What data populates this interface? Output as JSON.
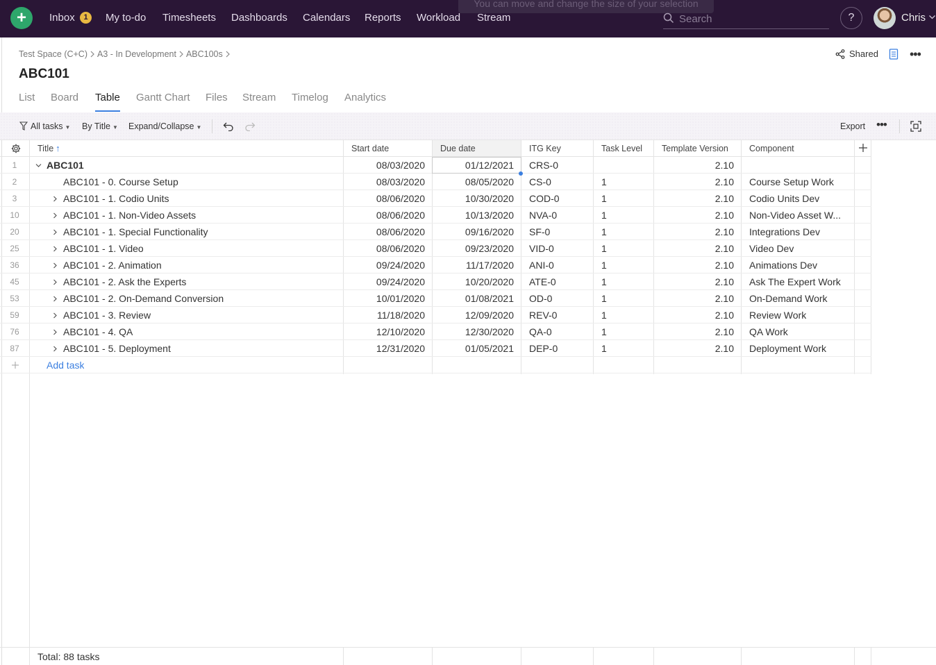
{
  "topbar": {
    "add_icon": "plus-icon",
    "nav": [
      {
        "label": "Inbox"
      },
      {
        "label": "My to-do"
      },
      {
        "label": "Timesheets"
      },
      {
        "label": "Dashboards"
      },
      {
        "label": "Calendars"
      },
      {
        "label": "Reports"
      },
      {
        "label": "Workload"
      },
      {
        "label": "Stream"
      }
    ],
    "inbox_badge": "1",
    "tooltip": "You can move and change the size of your selection",
    "search_placeholder": "Search",
    "help_label": "?",
    "user_name": "Chris"
  },
  "header": {
    "breadcrumb": [
      "Test Space (C+C)",
      "A3 - In Development",
      "ABC100s"
    ],
    "title": "ABC101",
    "shared_label": "Shared"
  },
  "tabs": [
    "List",
    "Board",
    "Table",
    "Gantt Chart",
    "Files",
    "Stream",
    "Timelog",
    "Analytics"
  ],
  "active_tab": "Table",
  "toolbar": {
    "filter_label": "All tasks",
    "sort_label": "By Title",
    "expand_label": "Expand/Collapse",
    "export_label": "Export"
  },
  "table": {
    "columns": [
      "Title",
      "Start date",
      "Due date",
      "ITG Key",
      "Task Level",
      "Template Version",
      "Component"
    ],
    "rows": [
      {
        "num": "1",
        "title": "ABC101",
        "start": "08/03/2020",
        "due": "01/12/2021",
        "key": "CRS-0",
        "level": "",
        "version": "2.10",
        "component": ""
      },
      {
        "num": "2",
        "title": "ABC101 - 0. Course Setup",
        "start": "08/03/2020",
        "due": "08/05/2020",
        "key": "CS-0",
        "level": "1",
        "version": "2.10",
        "component": "Course Setup Work"
      },
      {
        "num": "3",
        "title": "ABC101 - 1. Codio Units",
        "start": "08/06/2020",
        "due": "10/30/2020",
        "key": "COD-0",
        "level": "1",
        "version": "2.10",
        "component": "Codio Units Dev"
      },
      {
        "num": "10",
        "title": "ABC101 - 1. Non-Video Assets",
        "start": "08/06/2020",
        "due": "10/13/2020",
        "key": "NVA-0",
        "level": "1",
        "version": "2.10",
        "component": "Non-Video Asset W..."
      },
      {
        "num": "20",
        "title": "ABC101 - 1. Special Functionality",
        "start": "08/06/2020",
        "due": "09/16/2020",
        "key": "SF-0",
        "level": "1",
        "version": "2.10",
        "component": "Integrations Dev"
      },
      {
        "num": "25",
        "title": "ABC101 - 1. Video",
        "start": "08/06/2020",
        "due": "09/23/2020",
        "key": "VID-0",
        "level": "1",
        "version": "2.10",
        "component": "Video Dev"
      },
      {
        "num": "36",
        "title": "ABC101 - 2. Animation",
        "start": "09/24/2020",
        "due": "11/17/2020",
        "key": "ANI-0",
        "level": "1",
        "version": "2.10",
        "component": "Animations Dev"
      },
      {
        "num": "45",
        "title": "ABC101 - 2. Ask the Experts",
        "start": "09/24/2020",
        "due": "10/20/2020",
        "key": "ATE-0",
        "level": "1",
        "version": "2.10",
        "component": "Ask The Expert Work"
      },
      {
        "num": "53",
        "title": "ABC101 - 2. On-Demand Conversion",
        "start": "10/01/2020",
        "due": "01/08/2021",
        "key": "OD-0",
        "level": "1",
        "version": "2.10",
        "component": "On-Demand Work"
      },
      {
        "num": "59",
        "title": "ABC101 - 3. Review",
        "start": "11/18/2020",
        "due": "12/09/2020",
        "key": "REV-0",
        "level": "1",
        "version": "2.10",
        "component": "Review Work"
      },
      {
        "num": "76",
        "title": "ABC101 - 4. QA",
        "start": "12/10/2020",
        "due": "12/30/2020",
        "key": "QA-0",
        "level": "1",
        "version": "2.10",
        "component": "QA Work"
      },
      {
        "num": "87",
        "title": "ABC101 - 5. Deployment",
        "start": "12/31/2020",
        "due": "01/05/2021",
        "key": "DEP-0",
        "level": "1",
        "version": "2.10",
        "component": "Deployment Work"
      }
    ],
    "add_task_label": "Add task",
    "total_label": "Total: 88 tasks"
  }
}
